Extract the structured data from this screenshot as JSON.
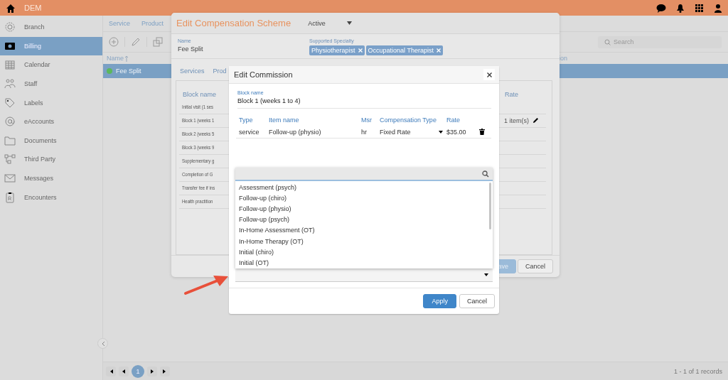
{
  "top_bar": {
    "title": "DEM"
  },
  "sidebar": {
    "items": [
      {
        "label": "Branch",
        "selected": false
      },
      {
        "label": "Billing",
        "selected": true
      },
      {
        "label": "Calendar",
        "selected": false
      },
      {
        "label": "Staff",
        "selected": false
      },
      {
        "label": "Labels",
        "selected": false
      },
      {
        "label": "eAccounts",
        "selected": false
      },
      {
        "label": "Documents",
        "selected": false
      },
      {
        "label": "Third Party",
        "selected": false
      },
      {
        "label": "Messages",
        "selected": false
      },
      {
        "label": "Encounters",
        "selected": false
      }
    ]
  },
  "list_panel": {
    "tabs": [
      {
        "label": "Service",
        "selected": false
      },
      {
        "label": "Product",
        "selected": false
      }
    ],
    "search": {
      "placeholder": "Search"
    },
    "columns": [
      "Name",
      "ion"
    ],
    "rows": [
      {
        "name": "Fee Split",
        "selected": true,
        "color": "#5cb85c"
      }
    ],
    "pagination": {
      "pages": [
        {
          "label": "1",
          "selected": true
        }
      ],
      "summary": "1 - 1 of 1 records"
    }
  },
  "scheme_dialog": {
    "title": "Edit Compensation Scheme",
    "status": "Active",
    "name_label": "Name",
    "name": "Fee Split",
    "specialty_label": "Supported Specialty",
    "specialties": [
      "Physiotherapist",
      "Occupational Therapist"
    ],
    "tabs": [
      {
        "label": "Services",
        "selected": false
      },
      {
        "label": "Prod",
        "selected": false
      }
    ],
    "columns": [
      "Block name",
      "Rate"
    ],
    "rows": [
      {
        "block": "Initial visit (1 ses"
      },
      {
        "block": "Block 1 (weeks 1",
        "rate": "1 item(s)"
      },
      {
        "block": "Block 2 (weeks 5"
      },
      {
        "block": "Block 3 (weeks 9"
      },
      {
        "block": "Supplementary g"
      },
      {
        "block": "Completion of G"
      },
      {
        "block": "Transfer fee if ins"
      },
      {
        "block": "Health practition"
      }
    ],
    "buttons": [
      {
        "label": "ave",
        "kind": "primary"
      },
      {
        "label": "Cancel",
        "kind": "default"
      }
    ]
  },
  "commission_dialog": {
    "title": "Edit Commission",
    "block_label": "Block name",
    "block_name": "Block 1 (weeks 1 to 4)",
    "columns": [
      "Type",
      "Item name",
      "Msr",
      "Compensation Type",
      "Rate"
    ],
    "rows": [
      {
        "type": "service",
        "item": "Follow-up (physio)",
        "msr": "hr",
        "compensation_type": "Fixed Rate",
        "rate": "$35.00"
      }
    ],
    "item_select": {
      "expanded": true,
      "options": [
        "Assessment (psych)",
        "Follow-up (chiro)",
        "Follow-up (physio)",
        "Follow-up (psych)",
        "In-Home Assessment (OT)",
        "In-Home Therapy (OT)",
        "Initial (chiro)",
        "Initial (OT)"
      ]
    },
    "buttons": [
      {
        "label": "Apply",
        "kind": "primary"
      },
      {
        "label": "Cancel",
        "kind": "default"
      }
    ]
  }
}
